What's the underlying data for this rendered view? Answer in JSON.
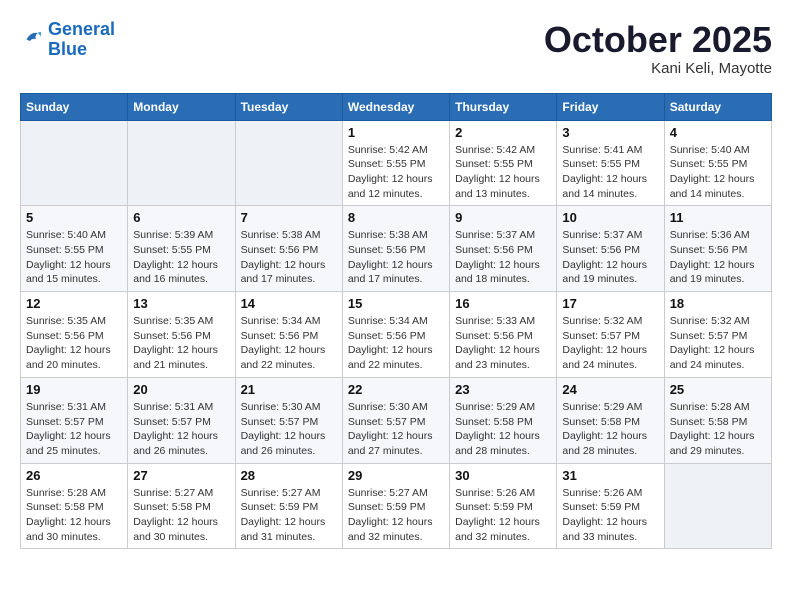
{
  "logo": {
    "line1": "General",
    "line2": "Blue"
  },
  "title": "October 2025",
  "location": "Kani Keli, Mayotte",
  "weekdays": [
    "Sunday",
    "Monday",
    "Tuesday",
    "Wednesday",
    "Thursday",
    "Friday",
    "Saturday"
  ],
  "weeks": [
    [
      {
        "num": "",
        "info": ""
      },
      {
        "num": "",
        "info": ""
      },
      {
        "num": "",
        "info": ""
      },
      {
        "num": "1",
        "info": "Sunrise: 5:42 AM\nSunset: 5:55 PM\nDaylight: 12 hours\nand 12 minutes."
      },
      {
        "num": "2",
        "info": "Sunrise: 5:42 AM\nSunset: 5:55 PM\nDaylight: 12 hours\nand 13 minutes."
      },
      {
        "num": "3",
        "info": "Sunrise: 5:41 AM\nSunset: 5:55 PM\nDaylight: 12 hours\nand 14 minutes."
      },
      {
        "num": "4",
        "info": "Sunrise: 5:40 AM\nSunset: 5:55 PM\nDaylight: 12 hours\nand 14 minutes."
      }
    ],
    [
      {
        "num": "5",
        "info": "Sunrise: 5:40 AM\nSunset: 5:55 PM\nDaylight: 12 hours\nand 15 minutes."
      },
      {
        "num": "6",
        "info": "Sunrise: 5:39 AM\nSunset: 5:55 PM\nDaylight: 12 hours\nand 16 minutes."
      },
      {
        "num": "7",
        "info": "Sunrise: 5:38 AM\nSunset: 5:56 PM\nDaylight: 12 hours\nand 17 minutes."
      },
      {
        "num": "8",
        "info": "Sunrise: 5:38 AM\nSunset: 5:56 PM\nDaylight: 12 hours\nand 17 minutes."
      },
      {
        "num": "9",
        "info": "Sunrise: 5:37 AM\nSunset: 5:56 PM\nDaylight: 12 hours\nand 18 minutes."
      },
      {
        "num": "10",
        "info": "Sunrise: 5:37 AM\nSunset: 5:56 PM\nDaylight: 12 hours\nand 19 minutes."
      },
      {
        "num": "11",
        "info": "Sunrise: 5:36 AM\nSunset: 5:56 PM\nDaylight: 12 hours\nand 19 minutes."
      }
    ],
    [
      {
        "num": "12",
        "info": "Sunrise: 5:35 AM\nSunset: 5:56 PM\nDaylight: 12 hours\nand 20 minutes."
      },
      {
        "num": "13",
        "info": "Sunrise: 5:35 AM\nSunset: 5:56 PM\nDaylight: 12 hours\nand 21 minutes."
      },
      {
        "num": "14",
        "info": "Sunrise: 5:34 AM\nSunset: 5:56 PM\nDaylight: 12 hours\nand 22 minutes."
      },
      {
        "num": "15",
        "info": "Sunrise: 5:34 AM\nSunset: 5:56 PM\nDaylight: 12 hours\nand 22 minutes."
      },
      {
        "num": "16",
        "info": "Sunrise: 5:33 AM\nSunset: 5:56 PM\nDaylight: 12 hours\nand 23 minutes."
      },
      {
        "num": "17",
        "info": "Sunrise: 5:32 AM\nSunset: 5:57 PM\nDaylight: 12 hours\nand 24 minutes."
      },
      {
        "num": "18",
        "info": "Sunrise: 5:32 AM\nSunset: 5:57 PM\nDaylight: 12 hours\nand 24 minutes."
      }
    ],
    [
      {
        "num": "19",
        "info": "Sunrise: 5:31 AM\nSunset: 5:57 PM\nDaylight: 12 hours\nand 25 minutes."
      },
      {
        "num": "20",
        "info": "Sunrise: 5:31 AM\nSunset: 5:57 PM\nDaylight: 12 hours\nand 26 minutes."
      },
      {
        "num": "21",
        "info": "Sunrise: 5:30 AM\nSunset: 5:57 PM\nDaylight: 12 hours\nand 26 minutes."
      },
      {
        "num": "22",
        "info": "Sunrise: 5:30 AM\nSunset: 5:57 PM\nDaylight: 12 hours\nand 27 minutes."
      },
      {
        "num": "23",
        "info": "Sunrise: 5:29 AM\nSunset: 5:58 PM\nDaylight: 12 hours\nand 28 minutes."
      },
      {
        "num": "24",
        "info": "Sunrise: 5:29 AM\nSunset: 5:58 PM\nDaylight: 12 hours\nand 28 minutes."
      },
      {
        "num": "25",
        "info": "Sunrise: 5:28 AM\nSunset: 5:58 PM\nDaylight: 12 hours\nand 29 minutes."
      }
    ],
    [
      {
        "num": "26",
        "info": "Sunrise: 5:28 AM\nSunset: 5:58 PM\nDaylight: 12 hours\nand 30 minutes."
      },
      {
        "num": "27",
        "info": "Sunrise: 5:27 AM\nSunset: 5:58 PM\nDaylight: 12 hours\nand 30 minutes."
      },
      {
        "num": "28",
        "info": "Sunrise: 5:27 AM\nSunset: 5:59 PM\nDaylight: 12 hours\nand 31 minutes."
      },
      {
        "num": "29",
        "info": "Sunrise: 5:27 AM\nSunset: 5:59 PM\nDaylight: 12 hours\nand 32 minutes."
      },
      {
        "num": "30",
        "info": "Sunrise: 5:26 AM\nSunset: 5:59 PM\nDaylight: 12 hours\nand 32 minutes."
      },
      {
        "num": "31",
        "info": "Sunrise: 5:26 AM\nSunset: 5:59 PM\nDaylight: 12 hours\nand 33 minutes."
      },
      {
        "num": "",
        "info": ""
      }
    ]
  ]
}
